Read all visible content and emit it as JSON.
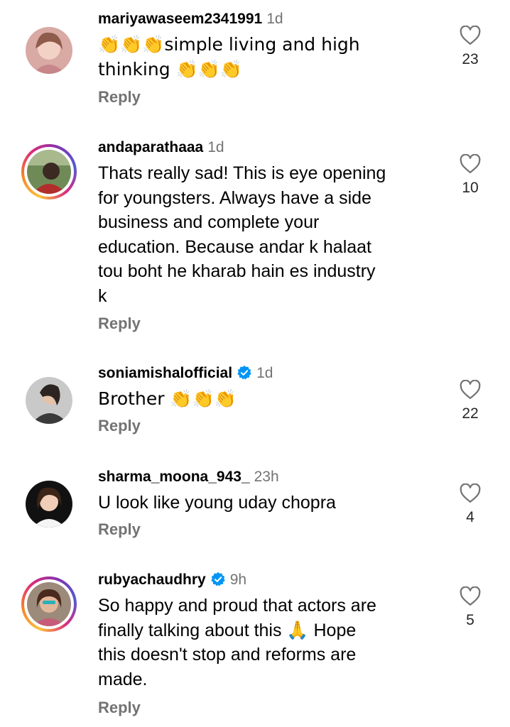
{
  "comments": [
    {
      "username": "mariyawaseem2341991",
      "time": "1d",
      "text": "👏👏👏simple living and high\nthinking 👏👏👏",
      "reply_label": "Reply",
      "likes": "23",
      "verified": false,
      "story_ring": false
    },
    {
      "username": "andaparathaaa",
      "time": "1d",
      "text": "Thats really sad! This is eye opening\nfor youngsters. Always have a side\nbusiness and complete your\neducation. Because andar k halaat\ntou boht he kharab hain es industry\nk",
      "reply_label": "Reply",
      "likes": "10",
      "verified": false,
      "story_ring": true
    },
    {
      "username": "soniamishalofficial",
      "time": "1d",
      "text": "Brother 👏👏👏",
      "reply_label": "Reply",
      "likes": "22",
      "verified": true,
      "story_ring": false
    },
    {
      "username": "sharma_moona_943_",
      "time": "23h",
      "text": "U look like young uday chopra",
      "reply_label": "Reply",
      "likes": "4",
      "verified": false,
      "story_ring": false
    },
    {
      "username": "rubyachaudhry",
      "time": "9h",
      "text": "So happy and proud that actors are\nfinally talking about this 🙏 Hope\nthis doesn't stop and reforms are\nmade.",
      "reply_label": "Reply",
      "likes": "5",
      "verified": true,
      "story_ring": true
    }
  ],
  "icons": {
    "like": "heart-outline-icon",
    "verified": "verified-badge-icon"
  },
  "colors": {
    "secondary_text": "#737373",
    "verified_blue": "#0095f6",
    "ring_start": "#f9c23c",
    "ring_end": "#8134af"
  }
}
